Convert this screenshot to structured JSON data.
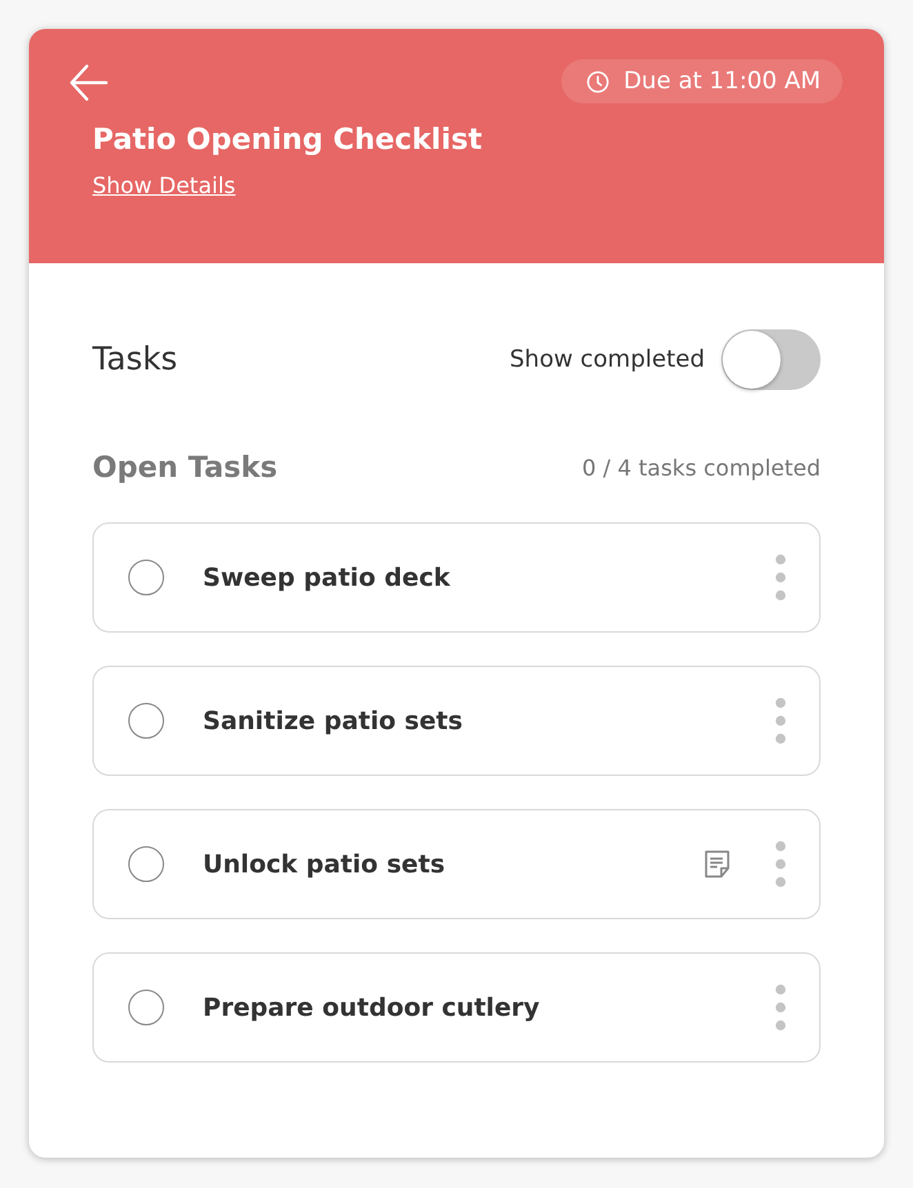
{
  "header": {
    "due": "Due at 11:00 AM",
    "title": "Patio Opening Checklist",
    "details_link": "Show Details"
  },
  "tasks_section": {
    "title": "Tasks",
    "show_completed_label": "Show completed",
    "show_completed": false
  },
  "open_tasks": {
    "title": "Open Tasks",
    "progress": "0 / 4 tasks completed"
  },
  "tasks": [
    {
      "name": "Sweep patio deck",
      "checked": false,
      "has_note": false
    },
    {
      "name": "Sanitize patio sets",
      "checked": false,
      "has_note": false
    },
    {
      "name": "Unlock patio sets",
      "checked": false,
      "has_note": true
    },
    {
      "name": "Prepare outdoor cutlery",
      "checked": false,
      "has_note": false
    }
  ]
}
